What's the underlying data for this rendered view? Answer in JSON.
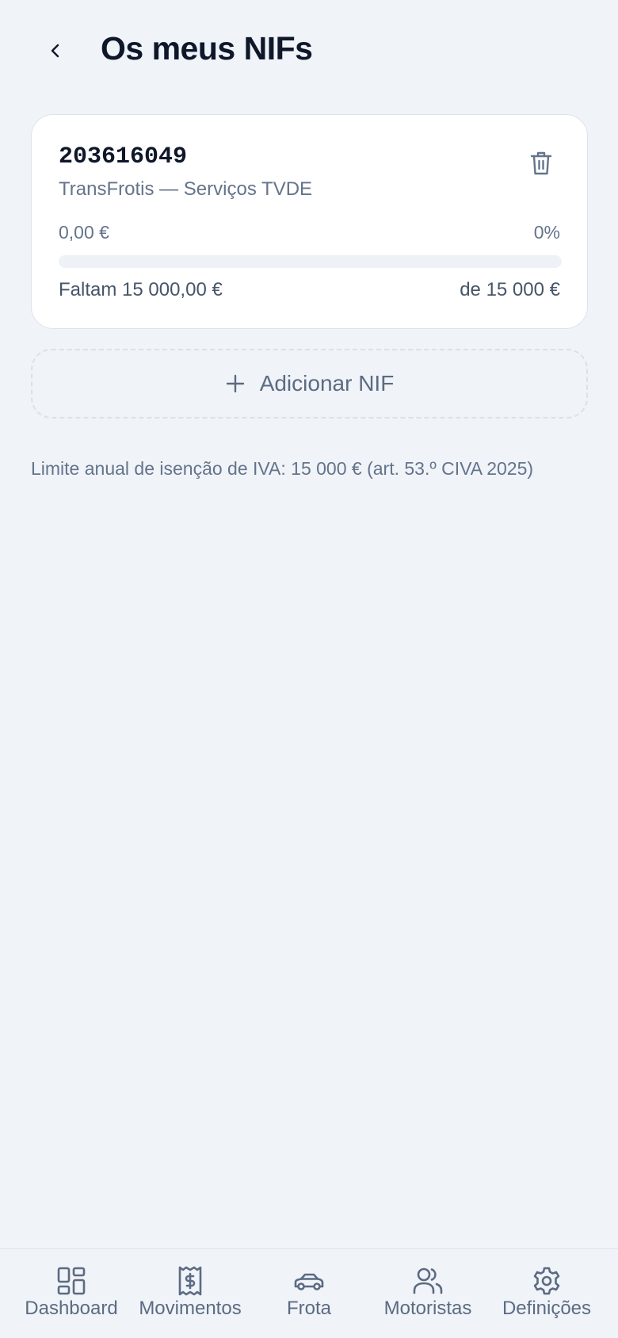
{
  "header": {
    "title": "Os meus NIFs",
    "back_icon": "chevron-left-icon"
  },
  "nif_card": {
    "nif": "203616049",
    "name": "TransFrotis — Serviços TVDE",
    "amount": "0,00 €",
    "percent_label": "0%",
    "progress_fraction": 0,
    "remaining": "Faltam 15 000,00 €",
    "limit": "de 15 000 €",
    "delete_icon": "trash-icon",
    "progress_color": "#3b82f6"
  },
  "add_button": {
    "label": "Adicionar NIF",
    "icon": "plus-icon"
  },
  "footnote": "Limite anual de isenção de IVA: 15 000 € (art. 53.º CIVA 2025)",
  "bottom_nav": {
    "items": [
      {
        "label": "Dashboard",
        "icon": "dashboard-icon"
      },
      {
        "label": "Movimentos",
        "icon": "receipt-icon"
      },
      {
        "label": "Frota",
        "icon": "car-icon"
      },
      {
        "label": "Motoristas",
        "icon": "users-icon"
      },
      {
        "label": "Definições",
        "icon": "settings-icon"
      }
    ]
  }
}
